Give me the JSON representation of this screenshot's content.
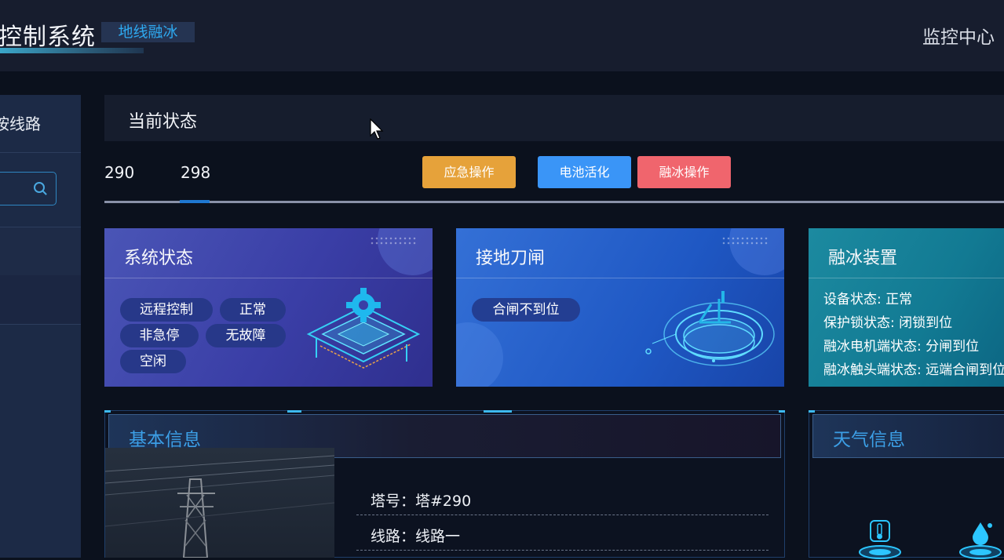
{
  "header": {
    "app_title": "控制系统",
    "module_badge": "地线融冰",
    "monitor_link": "监控中心"
  },
  "sidebar": {
    "title": "按线路",
    "search_placeholder": ""
  },
  "status": {
    "title": "当前状态",
    "tower_tabs": [
      "290",
      "298"
    ],
    "active_tab": "298",
    "buttons": {
      "emergency": "应急操作",
      "battery": "电池活化",
      "deice": "融冰操作"
    }
  },
  "cards": {
    "system": {
      "title": "系统状态",
      "tags": [
        "远程控制",
        "正常",
        "非急停",
        "无故障",
        "空闲"
      ]
    },
    "ground_switch": {
      "title": "接地刀闸",
      "tags": [
        "合闸不到位"
      ]
    },
    "deice_device": {
      "title": "融冰装置",
      "lines": [
        "设备状态: 正常",
        "保护锁状态: 闭锁到位",
        "融冰电机端状态: 分闸到位",
        "融冰触头端状态: 远端合闸到位"
      ]
    }
  },
  "basic_info": {
    "title": "基本信息",
    "rows": [
      "塔号：塔#290",
      "线路：线路一"
    ]
  },
  "weather": {
    "title": "天气信息",
    "icons": [
      "thermometer-icon",
      "humidity-icon"
    ]
  },
  "colors": {
    "accent_blue": "#3a95f7",
    "warning_orange": "#e6a23a",
    "danger_red": "#f0656d",
    "title_blue": "#3c9fe6"
  }
}
